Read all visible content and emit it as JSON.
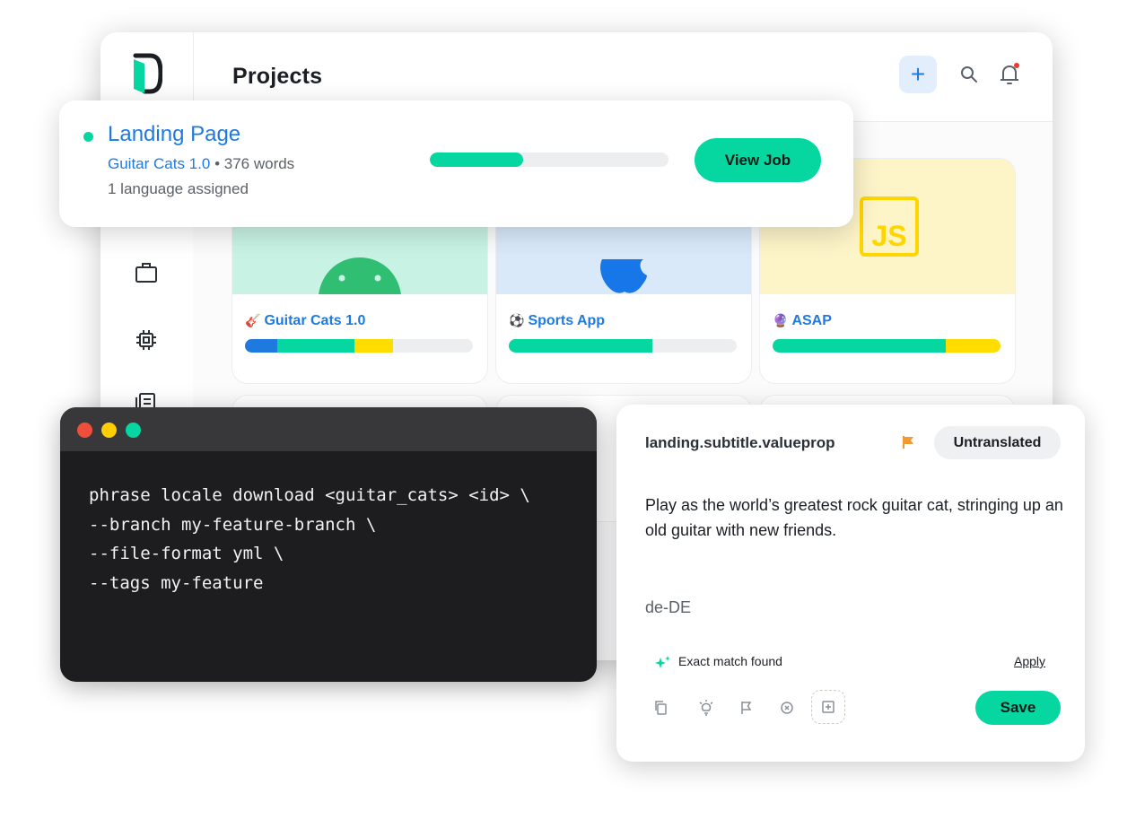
{
  "app": {
    "title": "Projects",
    "header_icons": [
      "plus-icon",
      "search-icon",
      "bell-icon"
    ],
    "sidebar_icons": [
      "logo-icon",
      "briefcase-icon",
      "chip-icon",
      "document-list-icon"
    ]
  },
  "projects": [
    {
      "name": "Guitar Cats 1.0",
      "emoji": "🎸",
      "platform": "android-icon",
      "top_color": "#c8f3e4",
      "progress": [
        {
          "color": "#1f7ae0",
          "fraction": 0.14
        },
        {
          "color": "#06d7a0",
          "fraction": 0.34
        },
        {
          "color": "#ffdd00",
          "fraction": 0.17
        }
      ]
    },
    {
      "name": "Sports App",
      "emoji": "⚽",
      "platform": "apple-icon",
      "top_color": "#d9e9f9",
      "progress": [
        {
          "color": "#06d7a0",
          "fraction": 0.63
        }
      ]
    },
    {
      "name": "ASAP",
      "emoji": "🔮",
      "platform": "js-icon",
      "top_color": "#fdf4c8",
      "progress": [
        {
          "color": "#06d7a0",
          "fraction": 0.76
        },
        {
          "color": "#ffdd00",
          "fraction": 0.24
        }
      ]
    }
  ],
  "job": {
    "title": "Landing Page",
    "project": "Guitar Cats 1.0",
    "separator": "•",
    "words": "376 words",
    "languages": "1 language assigned",
    "progress": 0.39,
    "button": "View Job"
  },
  "terminal": {
    "dots": [
      "#ee4f3a",
      "#ffcd00",
      "#06d7a0"
    ],
    "lines": [
      "phrase locale download <guitar_cats> <id> \\",
      "--branch my-feature-branch \\",
      "--file-format yml \\",
      "--tags my-feature"
    ]
  },
  "editor": {
    "key": "landing.subtitle.valueprop",
    "status": "Untranslated",
    "source_text": "Play as the world’s greatest rock guitar cat, stringing up an old guitar with new friends.",
    "locale": "de-DE",
    "match_text": "Exact match found",
    "apply": "Apply",
    "save": "Save",
    "tools": [
      "copy-icon",
      "lightbulb-icon",
      "flag-icon",
      "clear-icon",
      "add-box-icon"
    ]
  },
  "colors": {
    "accent": "#06d7a0",
    "link": "#1f7ae0",
    "yellow": "#ffdd00",
    "flag": "#f39a34"
  }
}
